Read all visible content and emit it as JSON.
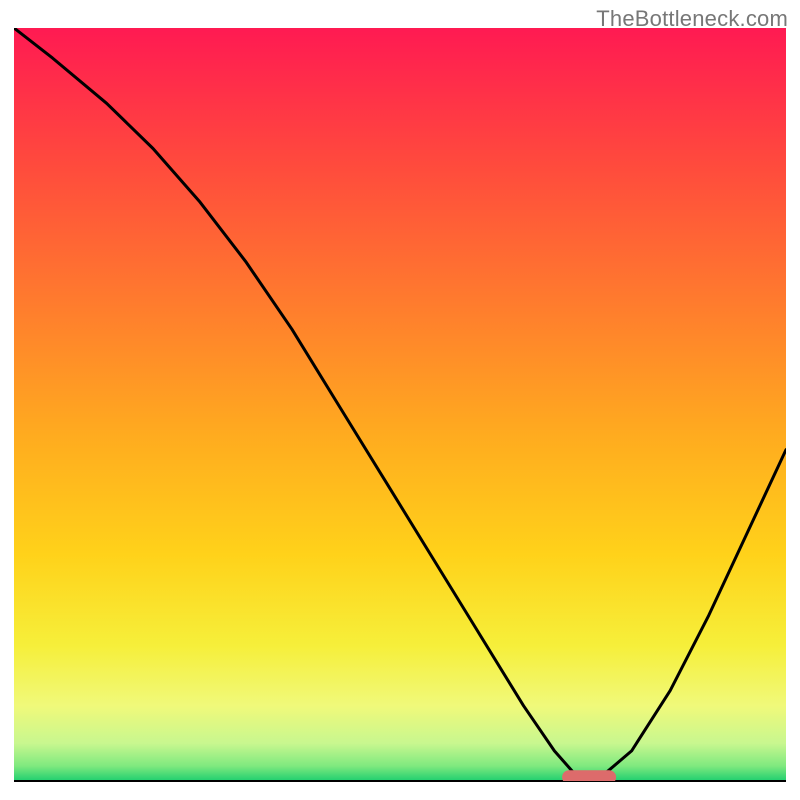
{
  "watermark": "TheBottleneck.com",
  "chart_data": {
    "type": "line",
    "title": "",
    "xlabel": "",
    "ylabel": "",
    "xlim": [
      0,
      100
    ],
    "ylim": [
      0,
      100
    ],
    "grid": false,
    "legend": false,
    "series": [
      {
        "name": "bottleneck-curve",
        "x": [
          0,
          5,
          12,
          18,
          24,
          30,
          36,
          42,
          48,
          54,
          60,
          66,
          70,
          73,
          76,
          80,
          85,
          90,
          95,
          100
        ],
        "y": [
          100,
          96,
          90,
          84,
          77,
          69,
          60,
          50,
          40,
          30,
          20,
          10,
          4,
          0.5,
          0.5,
          4,
          12,
          22,
          33,
          44
        ]
      }
    ],
    "marker": {
      "name": "optimal-zone",
      "x_start": 71,
      "x_end": 78,
      "y": 0.5
    },
    "gradient_stops": [
      {
        "offset": 0.0,
        "color": "#ff1a52"
      },
      {
        "offset": 0.18,
        "color": "#ff4a3d"
      },
      {
        "offset": 0.36,
        "color": "#ff7a2e"
      },
      {
        "offset": 0.54,
        "color": "#ffab1f"
      },
      {
        "offset": 0.7,
        "color": "#ffd21a"
      },
      {
        "offset": 0.82,
        "color": "#f6ef3a"
      },
      {
        "offset": 0.9,
        "color": "#f0f97a"
      },
      {
        "offset": 0.95,
        "color": "#c8f78f"
      },
      {
        "offset": 0.98,
        "color": "#7fe97f"
      },
      {
        "offset": 1.0,
        "color": "#1fcf70"
      }
    ]
  }
}
